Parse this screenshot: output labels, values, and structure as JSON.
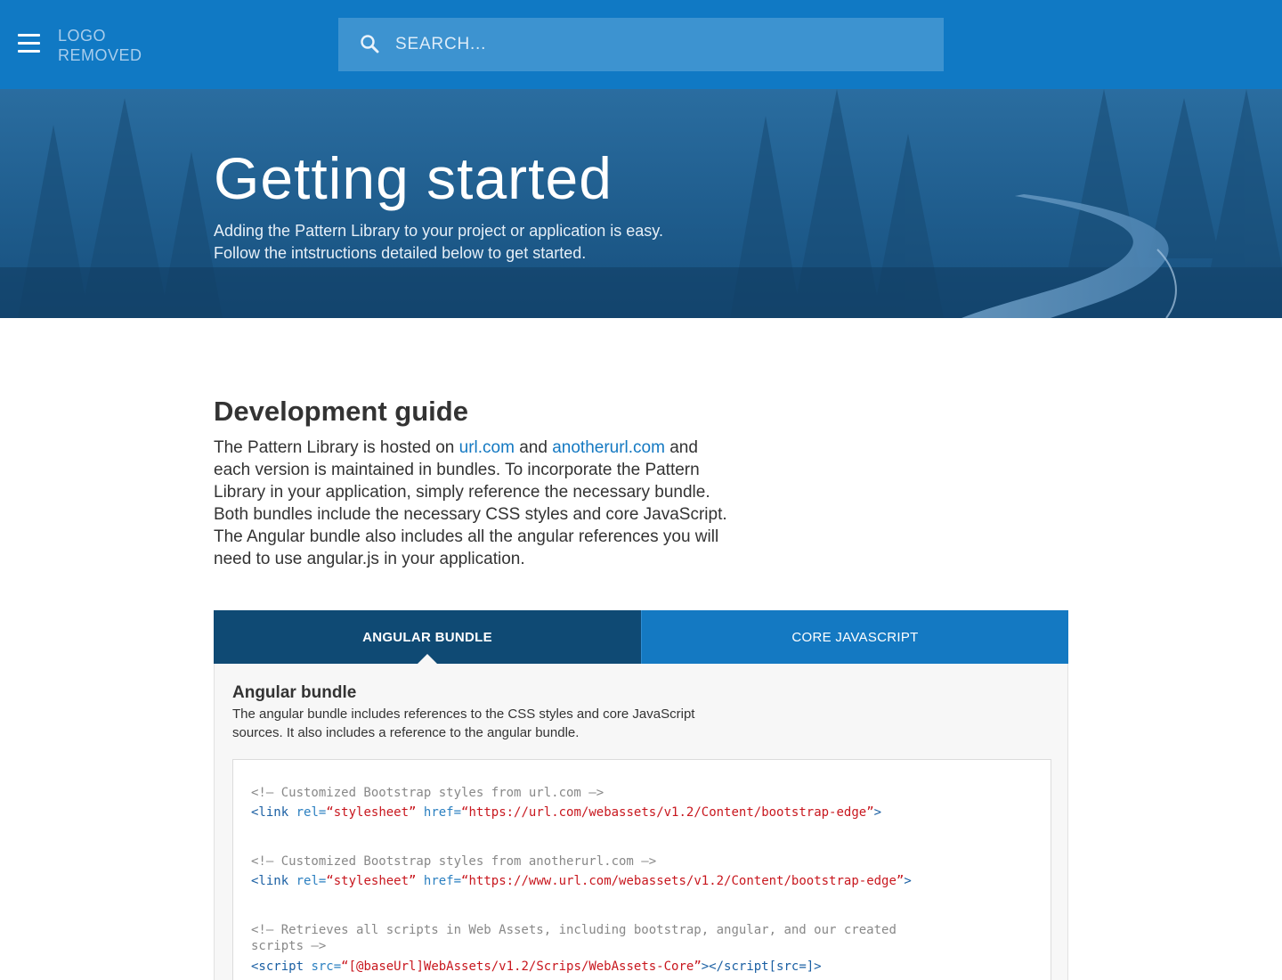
{
  "header": {
    "logo_line1": "LOGO",
    "logo_line2": "REMOVED",
    "search_placeholder": "SEARCH...",
    "icons": {
      "menu": "hamburger-menu-icon",
      "search": "search-icon"
    },
    "colors": {
      "bar": "#1079c4",
      "search_bg": "#3d93d0"
    }
  },
  "hero": {
    "title": "Getting started",
    "subtitle_line1": "Adding the Pattern Library to your project or application is easy.",
    "subtitle_line2": "Follow the intstructions detailed below to get started."
  },
  "dev_guide": {
    "title": "Development guide",
    "text_before": "The Pattern Library is hosted on ",
    "link1": "url.com",
    "text_middle": " and ",
    "link2": "anotherurl.com",
    "text_after": " and each version is maintained in bundles. To incorporate the Pattern Library in your application, simply reference the necessary bundle. Both bundles include the necessary CSS styles and core JavaScript. The Angular bundle also includes all the angular references you will need to use angular.js in your application."
  },
  "tabs": [
    {
      "label": "ANGULAR BUNDLE",
      "active": true
    },
    {
      "label": "CORE JAVASCRIPT",
      "active": false
    }
  ],
  "panel": {
    "title": "Angular bundle",
    "desc_line1": "The angular bundle includes references to the CSS styles and core JavaScript",
    "desc_line2": "sources. It also includes a reference to the angular bundle."
  },
  "code": {
    "comment1": "<!— Customized Bootstrap styles from url.com —>",
    "link1_open": "<link",
    "link1_rel_attr": " rel=",
    "link1_rel_val": "“stylesheet”",
    "link1_href_attr": " href=",
    "link1_href_val": "“https://url.com/webassets/v1.2/Content/bootstrap-edge”",
    "link1_close": ">",
    "comment2": "<!— Customized Bootstrap styles from anotherurl.com —>",
    "link2_open": "<link",
    "link2_rel_attr": " rel=",
    "link2_rel_val": "“stylesheet”",
    "link2_href_attr": " href=",
    "link2_href_val": "“https://www.url.com/webassets/v1.2/Content/bootstrap-edge”",
    "link2_close": ">",
    "comment3_line1": "<!— Retrieves all scripts in Web Assets, including bootstrap, angular, and our created",
    "comment3_line2": "scripts —>",
    "script_open": "<script",
    "script_src_attr": " src=",
    "script_src_val": "“[@baseUrl]WebAssets/v1.2/Scrips/WebAssets-Core”",
    "script_close": "></script[src=]>"
  }
}
